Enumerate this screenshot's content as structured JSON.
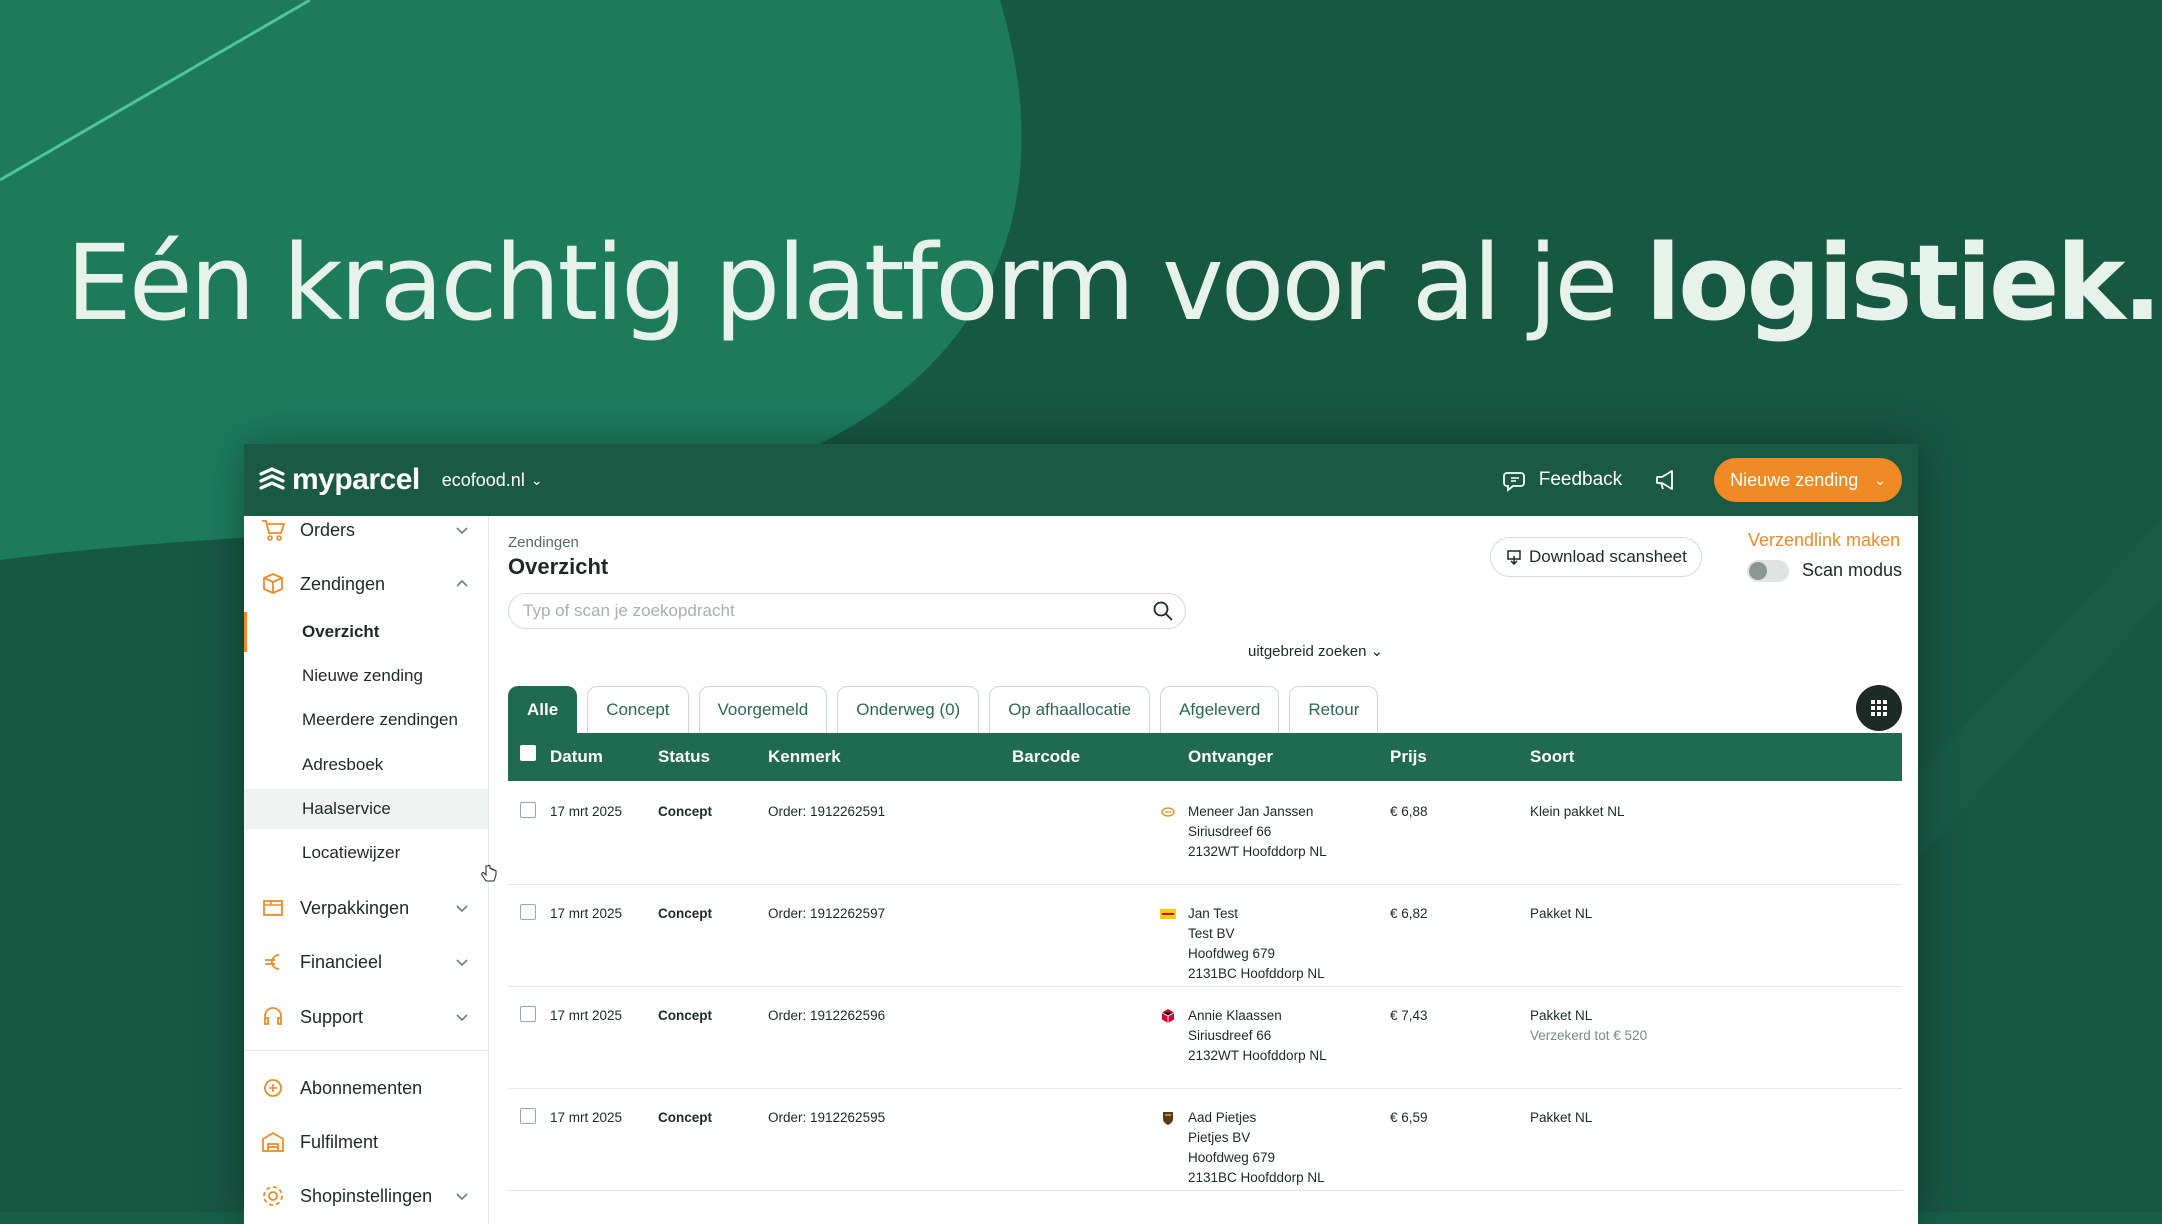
{
  "headline": {
    "regular": "Eén krachtig platform voor al je ",
    "bold": "logistiek."
  },
  "colors": {
    "brand_green": "#1a5a44",
    "accent_orange": "#f08a24",
    "table_green": "#1f6a50"
  },
  "topbar": {
    "logo_text": "myparcel",
    "shop": "ecofood.nl",
    "feedback": "Feedback",
    "new_shipment": "Nieuwe zending"
  },
  "sidebar": {
    "orders": "Orders",
    "zendingen": "Zendingen",
    "sub": [
      "Overzicht",
      "Nieuwe zending",
      "Meerdere zendingen",
      "Adresboek",
      "Haalservice",
      "Locatiewijzer"
    ],
    "verpakkingen": "Verpakkingen",
    "financieel": "Financieel",
    "support": "Support",
    "abonnementen": "Abonnementen",
    "fulfilment": "Fulfilment",
    "shopinstellingen": "Shopinstellingen"
  },
  "header": {
    "breadcrumb": "Zendingen",
    "title": "Overzicht",
    "download": "Download scansheet",
    "link": "Verzendlink maken",
    "scan_mode": "Scan modus"
  },
  "search": {
    "placeholder": "Typ of scan je zoekopdracht",
    "advanced": "uitgebreid zoeken"
  },
  "tabs": [
    "Alle",
    "Concept",
    "Voorgemeld",
    "Onderweg (0)",
    "Op afhaallocatie",
    "Afgeleverd",
    "Retour"
  ],
  "table": {
    "headers": [
      "Datum",
      "Status",
      "Kenmerk",
      "Barcode",
      "Ontvanger",
      "Prijs",
      "Soort"
    ],
    "rows": [
      {
        "date": "17 mrt 2025",
        "status": "Concept",
        "ref": "Order: 1912262591",
        "carrier": "postnl-icon",
        "r1": "Meneer Jan Janssen",
        "r2": "Siriusdreef 66",
        "r3": "2132WT Hoofddorp NL",
        "r4": "",
        "price": "€ 6,88",
        "type": "Klein pakket NL",
        "note": ""
      },
      {
        "date": "17 mrt 2025",
        "status": "Concept",
        "ref": "Order: 1912262597",
        "carrier": "dhl-icon",
        "r1": "Jan Test",
        "r2": "Test BV",
        "r3": "Hoofdweg 679",
        "r4": "2131BC Hoofddorp NL",
        "price": "€ 6,82",
        "type": "Pakket NL",
        "note": ""
      },
      {
        "date": "17 mrt 2025",
        "status": "Concept",
        "ref": "Order: 1912262596",
        "carrier": "dpd-icon",
        "r1": "Annie Klaassen",
        "r2": "Siriusdreef 66",
        "r3": "2132WT Hoofddorp NL",
        "r4": "",
        "price": "€ 7,43",
        "type": "Pakket NL",
        "note": "Verzekerd tot € 520"
      },
      {
        "date": "17 mrt 2025",
        "status": "Concept",
        "ref": "Order: 1912262595",
        "carrier": "ups-icon",
        "r1": "Aad Pietjes",
        "r2": "Pietjes BV",
        "r3": "Hoofdweg 679",
        "r4": "2131BC Hoofddorp NL",
        "price": "€ 6,59",
        "type": "Pakket NL",
        "note": ""
      }
    ]
  }
}
